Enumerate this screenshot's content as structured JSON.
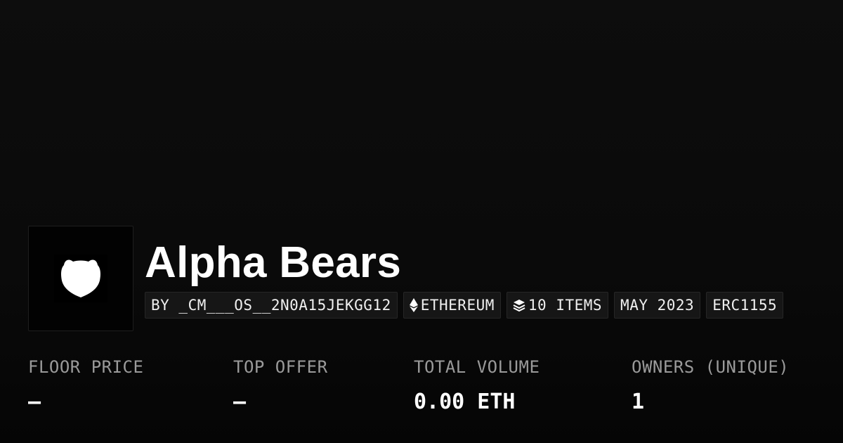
{
  "collection": {
    "name": "Alpha Bears",
    "logo_icon": "bear-shield-icon"
  },
  "tags": [
    {
      "label": "BY _CM___OS__2N0A15JEKGG12",
      "icon": ""
    },
    {
      "label": "ETHEREUM",
      "icon": "ethereum-icon"
    },
    {
      "label": "10 ITEMS",
      "icon": "layers-icon"
    },
    {
      "label": "MAY 2023",
      "icon": ""
    },
    {
      "label": "ERC1155",
      "icon": ""
    }
  ],
  "stats": [
    {
      "label": "FLOOR PRICE",
      "value": "–"
    },
    {
      "label": "TOP OFFER",
      "value": "–"
    },
    {
      "label": "TOTAL VOLUME",
      "value": "0.00 ETH"
    },
    {
      "label": "OWNERS (UNIQUE)",
      "value": "1"
    }
  ],
  "colors": {
    "background": "#0a0a0a",
    "text": "#ffffff",
    "muted_text": "#9a9a9a",
    "pill_background": "#161616"
  }
}
